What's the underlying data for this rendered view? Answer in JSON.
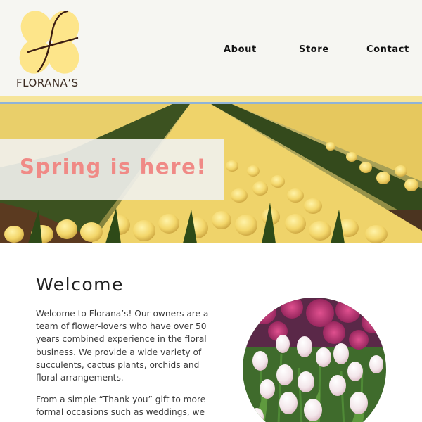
{
  "brand": {
    "name": "FLORANA’S",
    "logo_icon": "clover-flower-icon",
    "petal_color": "#fde58a",
    "stem_color": "#3a1c12"
  },
  "nav": {
    "items": [
      {
        "label": "About"
      },
      {
        "label": "Store"
      },
      {
        "label": "Contact"
      }
    ]
  },
  "colors": {
    "header_bg": "#f6f6f2",
    "stripe_yellow": "#f6e59a",
    "stripe_blue": "#8fb3d8",
    "hero_text": "#f08a86"
  },
  "hero": {
    "headline": "Spring is here!",
    "image": "yellow tulip field"
  },
  "welcome": {
    "title": "Welcome",
    "paragraph_1": "Welcome to Florana’s! Our owners are a team of flower-lovers who have over 50 years combined experience in the floral business. We provide a wide variety of succulents, cactus plants, orchids and floral arrangements.",
    "paragraph_2": "From a simple “Thank you” gift to more formal occasions such as weddings, we",
    "side_image": "pink and white tulips"
  }
}
